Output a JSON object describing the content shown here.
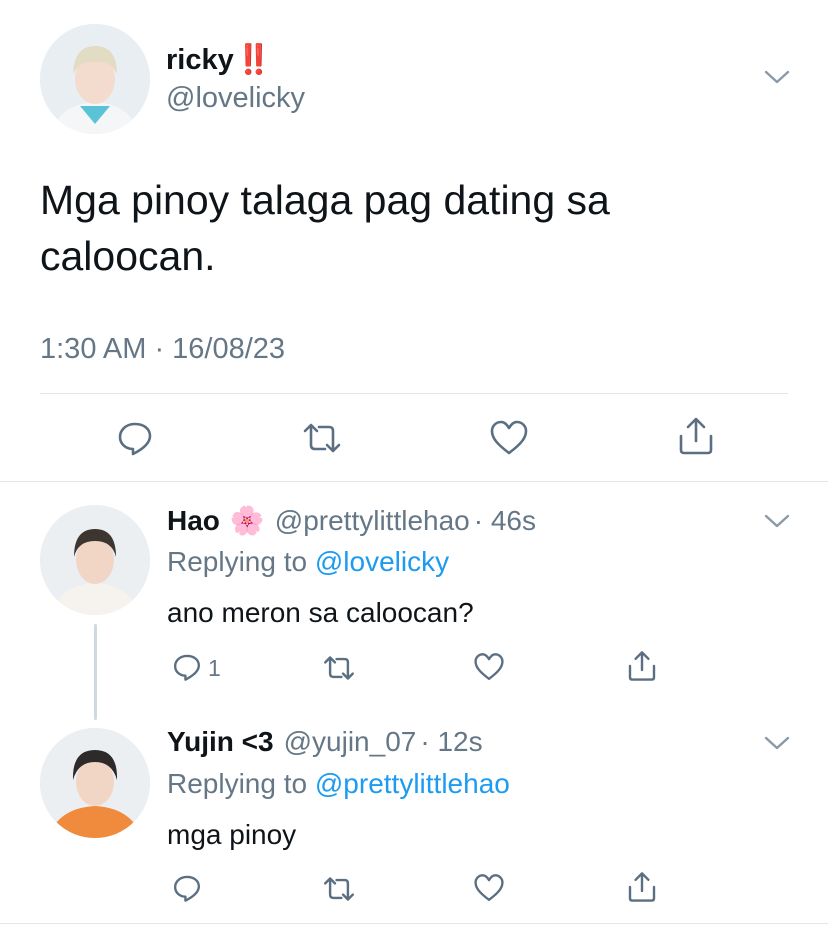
{
  "main_tweet": {
    "display_name": "ricky",
    "emoji": "‼️",
    "handle": "@lovelicky",
    "text_line1": "Mga pinoy talaga pag dating sa",
    "text_line2": "caloocan.",
    "timestamp": "1:30 AM · 16/08/23"
  },
  "replies": [
    {
      "display_name": "Hao",
      "emoji": "🌸",
      "handle": "@prettylittlehao",
      "time": "· 46s",
      "replying_prefix": "Replying to",
      "replying_to": "@lovelicky",
      "text": "ano meron sa caloocan?",
      "reply_count": "1"
    },
    {
      "display_name": "Yujin <3",
      "handle": "@yujin_07",
      "time": "· 12s",
      "replying_prefix": "Replying to",
      "replying_to": "@prettylittlehao",
      "text": "mga pinoy"
    }
  ],
  "icons": {
    "reply": "reply-icon",
    "retweet": "retweet-icon",
    "like": "heart-icon",
    "share": "share-icon",
    "more": "chevron-down-icon"
  },
  "colors": {
    "text": "#0f1419",
    "muted": "#657786",
    "link": "#1d9bf0",
    "divider": "#e1e8ed"
  }
}
